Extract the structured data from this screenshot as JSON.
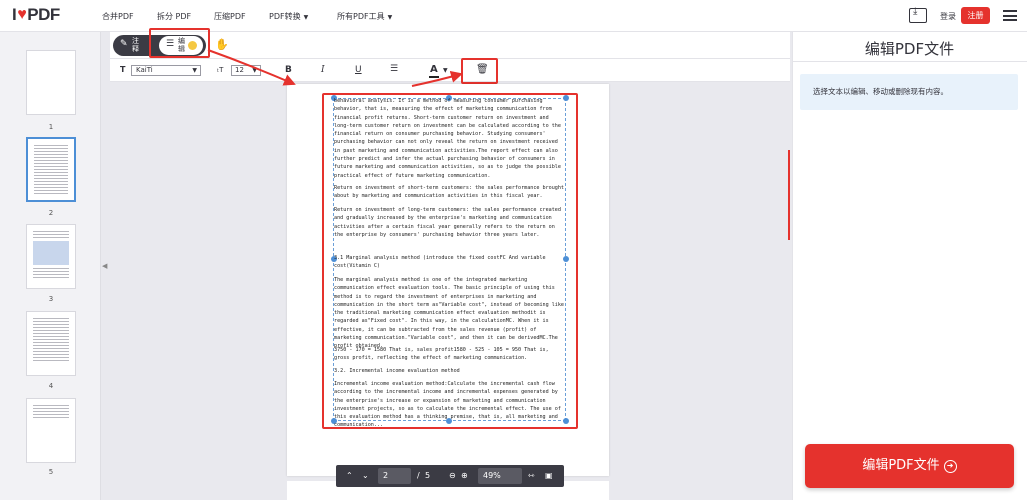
{
  "header": {
    "logo_left": "I",
    "logo_right": "PDF",
    "nav": [
      {
        "label": "合并PDF"
      },
      {
        "label": "拆分 PDF"
      },
      {
        "label": "压缩PDF"
      },
      {
        "label": "PDF转换"
      },
      {
        "label": "所有PDF工具"
      }
    ],
    "login": "登录",
    "register": "注册"
  },
  "thumbnails": [
    {
      "num": "1"
    },
    {
      "num": "2"
    },
    {
      "num": "3"
    },
    {
      "num": "4"
    },
    {
      "num": "5"
    }
  ],
  "toolbar": {
    "annotate_label": "注释",
    "edit_label": "编辑",
    "font_name": "KaiTi",
    "font_size": "12",
    "bold": "B",
    "italic": "I",
    "underline": "U",
    "text_color": "A"
  },
  "document": {
    "paragraphs": [
      "behavioral analysis. It is a method of measuring consumer purchasing behavior, that is, measuring the effect of marketing communication from financial profit returns. Short-term customer return on investment and long-term customer return on investment can be calculated according to the financial return on consumer purchasing behavior. Studying consumers' purchasing behavior can not only reveal the return on investment received in past marketing and communication activities.The report effect can also further predict and infer the actual purchasing behavior of consumers in future marketing and communication activities, so as to judge the possible practical effect of future marketing communication.",
      "Return on investment of short-term customers: the sales performance brought about by marketing and communication activities in this fiscal year.",
      "Return on investment of long-term customers: the sales performance created and gradually increased by the enterprise's marketing and communication activities after a certain fiscal year generally refers to the return on the enterprise by consumers' purchasing behavior three years later.",
      "3.1 Marginal analysis method (introduce the fixed costFC  And variable cost(Vitamin C)",
      "The marginal analysis method is one of the integrated marketing communication effect evaluation tools. The basic principle of using this method is to regard the investment of enterprises in marketing and communication in the short term as\"Variable cost\", instead of becoming like the traditional marketing communication effect evaluation methodit is regarded as\"Fixed cost\". In this way, in the calculationMC. When it is effective, it can be subtracted from the sales revenue (profit) of marketing communication.\"Variable cost\", and then it can be derivedMC.The profit obtained.",
      "3750 - 170 = 1580 That is, sales profit1580 - 525 - 105 = 950 That is, gross profit, reflecting the effect of marketing communication.",
      "3.2. Incremental income evaluation method",
      "Incremental income evaluation method:Calculate the incremental cash flow according to the incremental income and incremental expenses generated by the enterprise's increase or expansion of marketing and communication investment projects, so as to calculate the incremental effect. The use of this evaluation method has a thinking premise, that is, all marketing and communication..."
    ]
  },
  "pager": {
    "current_page": "2",
    "separator": "/",
    "total_pages": "5",
    "zoom": "49%"
  },
  "right_panel": {
    "title": "编辑PDF文件",
    "info": "选择文本以编辑、移动或删除现有内容。",
    "button": "编辑PDF文件"
  },
  "colors": {
    "brand_red": "#e5322d",
    "selection_blue": "#4d8fd6"
  },
  "icons": [
    "heart-icon",
    "download-icon",
    "menu-icon",
    "pencil-icon",
    "edit-icon",
    "hand-icon",
    "text-icon",
    "font-size-icon",
    "align-icon",
    "trash-icon",
    "chevron-up-icon",
    "chevron-down-icon",
    "zoom-out-icon",
    "zoom-in-icon",
    "fit-width-icon",
    "fit-page-icon",
    "arrow-right-circle-icon"
  ]
}
